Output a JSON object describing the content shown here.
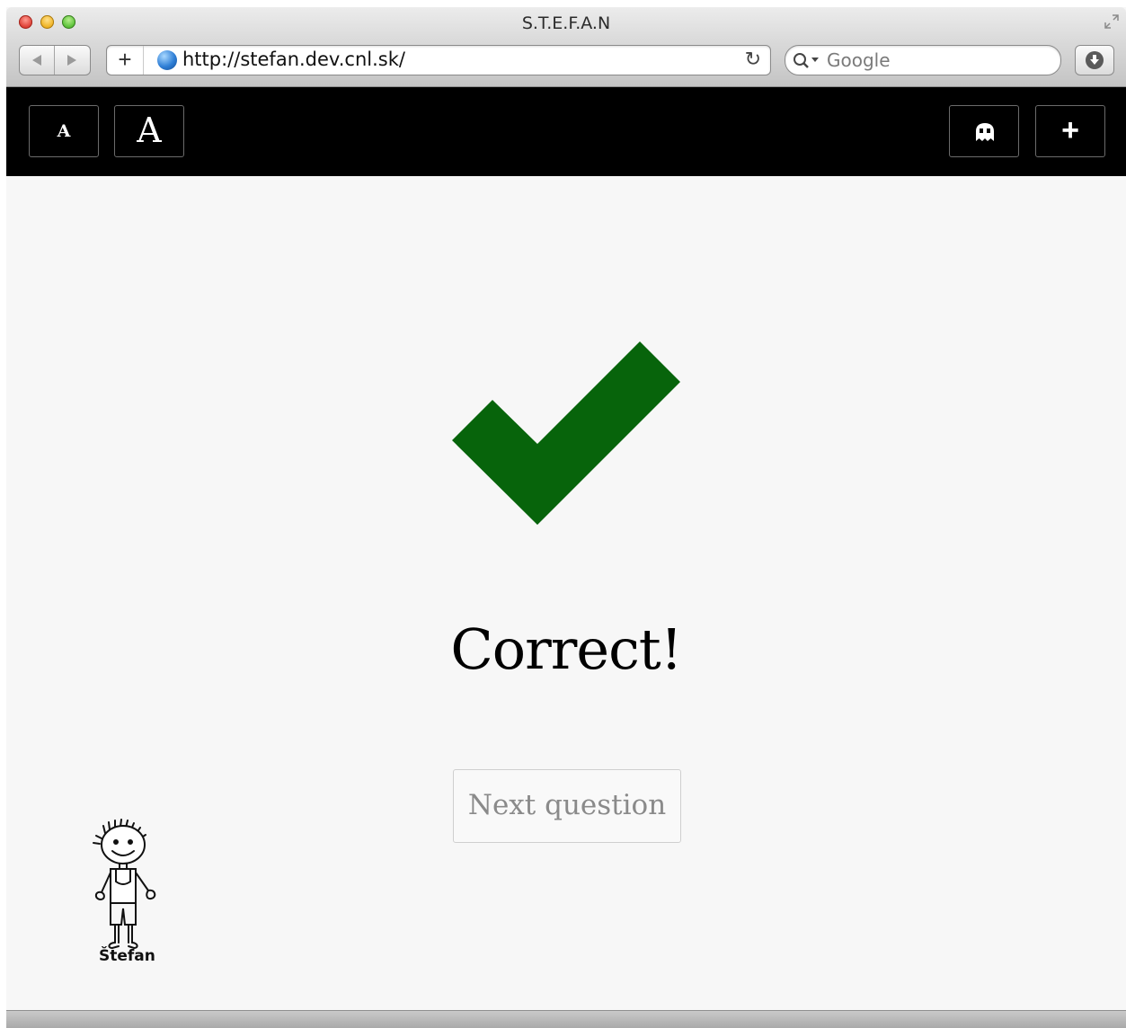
{
  "browser": {
    "window_title": "S.T.E.F.A.N",
    "url": "http://stefan.dev.cnl.sk/",
    "search_placeholder": "Google",
    "add_tab_label": "+"
  },
  "toolbar": {
    "font_small_label": "A",
    "font_large_label": "A",
    "add_label": "+"
  },
  "main": {
    "result_text": "Correct!",
    "next_button_label": "Next question",
    "check_color": "#07640b"
  },
  "mascot": {
    "name": "Štefan"
  }
}
